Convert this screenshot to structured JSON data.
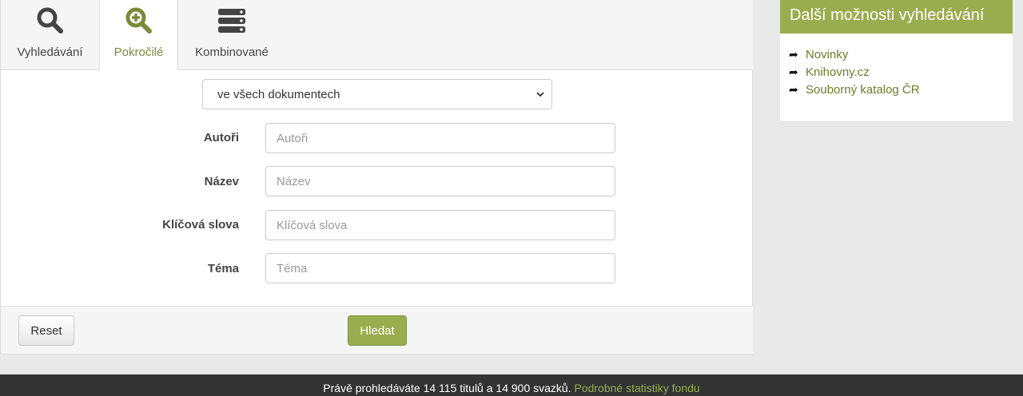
{
  "tabs": [
    {
      "label": "Vyhledávání",
      "icon": "search-icon"
    },
    {
      "label": "Pokročilé",
      "icon": "search-plus-icon",
      "active": true
    },
    {
      "label": "Kombinované",
      "icon": "stack-icon"
    }
  ],
  "form": {
    "scope_select": {
      "value": "ve všech dokumentech"
    },
    "fields": [
      {
        "label": "Autoři",
        "placeholder": "Autoři",
        "value": ""
      },
      {
        "label": "Název",
        "placeholder": "Název",
        "value": ""
      },
      {
        "label": "Klíčová slova",
        "placeholder": "Klíčová slova",
        "value": ""
      },
      {
        "label": "Téma",
        "placeholder": "Téma",
        "value": ""
      }
    ],
    "reset_label": "Reset",
    "search_label": "Hledat"
  },
  "sidebar": {
    "title": "Další možnosti vyhledávání",
    "links": [
      {
        "label": "Novinky",
        "icon": "arrow-right-icon"
      },
      {
        "label": "Knihovny.cz",
        "icon": "arrow-right-icon"
      },
      {
        "label": "Souborný katalog ČR",
        "icon": "arrow-right-icon"
      }
    ]
  },
  "footer": {
    "text": "Právě prohledáváte 14 115 titulů a 14 900 svazků.",
    "link": "Podrobné statistiky fondu"
  },
  "colors": {
    "accent": "#9aad4e",
    "accent_text": "#7a8a3a",
    "footer_bg": "#333333"
  }
}
